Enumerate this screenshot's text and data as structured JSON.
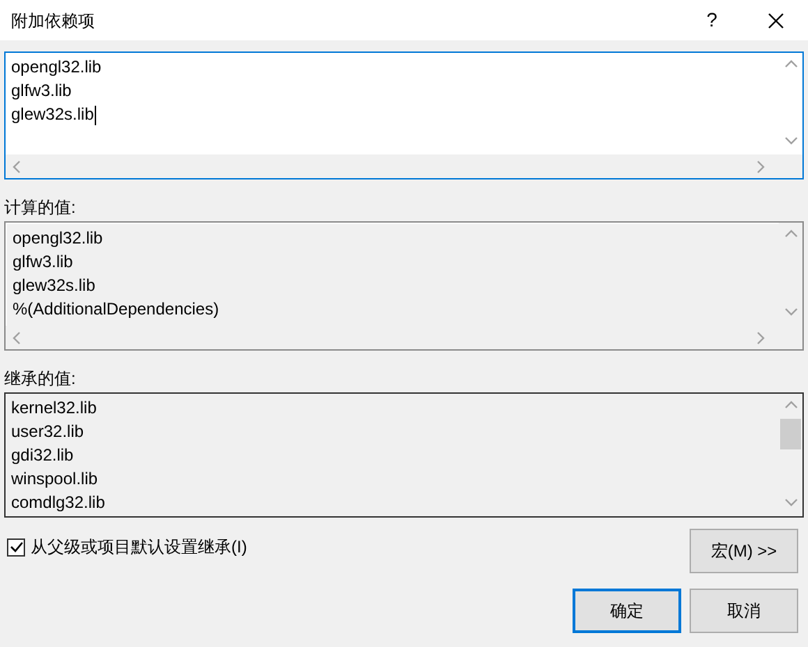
{
  "window": {
    "title": "附加依赖项",
    "help": "?"
  },
  "edit_box": {
    "lines": [
      "opengl32.lib",
      "glfw3.lib",
      "glew32s.lib"
    ]
  },
  "computed": {
    "label": "计算的值:",
    "lines": [
      "opengl32.lib",
      "glfw3.lib",
      "glew32s.lib",
      "%(AdditionalDependencies)"
    ]
  },
  "inherited": {
    "label": "继承的值:",
    "lines": [
      "kernel32.lib",
      "user32.lib",
      "gdi32.lib",
      "winspool.lib",
      "comdlg32.lib"
    ]
  },
  "inherit_checkbox": {
    "label": "从父级或项目默认设置继承(I)",
    "checked": true
  },
  "macro_button": "宏(M) >>",
  "buttons": [
    {
      "label": "确定",
      "default": true
    },
    {
      "label": "取消",
      "default": false
    }
  ]
}
